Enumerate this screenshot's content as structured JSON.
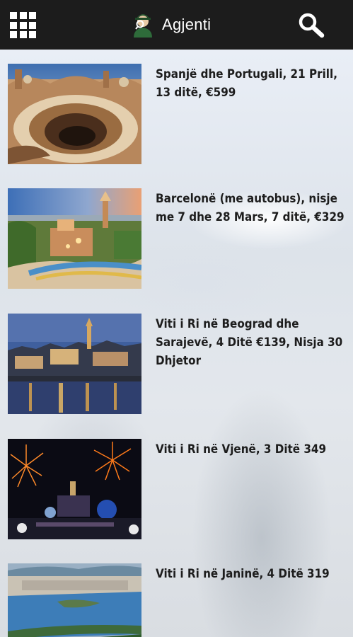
{
  "header": {
    "title": "Agjenti",
    "icons": {
      "menu": "grid-menu-icon",
      "logo": "agent-logo-icon",
      "search": "search-icon"
    },
    "background": "#1c1c1c"
  },
  "offers": [
    {
      "title": "Spanjë dhe Portugali, 21 Prill, 13 ditë, €599",
      "image": "casa-mila-rooftop"
    },
    {
      "title": "Barcelonë (me autobus), nisje me 7 dhe 28 Mars, 7 ditë, €329",
      "image": "park-guell-sunset"
    },
    {
      "title": "Viti i Ri në Beograd dhe Sarajevë, 4 Ditë €139, Nisja 30 Dhjetor",
      "image": "belgrade-riverfront-night"
    },
    {
      "title": "Viti i Ri në Vjenë, 3 Ditë 349",
      "image": "vienna-fireworks-concert"
    },
    {
      "title": "Viti i Ri në Janinë, 4 Ditë 319",
      "image": "ioannina-lake-aerial"
    }
  ]
}
